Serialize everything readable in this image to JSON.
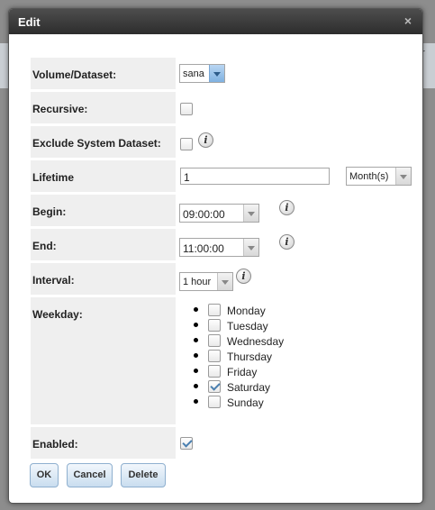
{
  "background": {
    "fragment": "or"
  },
  "dialog": {
    "title": "Edit",
    "close_icon": "×"
  },
  "form": {
    "volume": {
      "label": "Volume/Dataset:",
      "value": "sana"
    },
    "recursive": {
      "label": "Recursive:",
      "checked": false
    },
    "exclude_system": {
      "label": "Exclude System Dataset:",
      "checked": false,
      "info_icon": "i"
    },
    "lifetime": {
      "label": "Lifetime",
      "value": "1",
      "unit": "Month(s)"
    },
    "begin": {
      "label": "Begin:",
      "value": "09:00:00",
      "info_icon": "i"
    },
    "end": {
      "label": "End:",
      "value": "11:00:00",
      "info_icon": "i"
    },
    "interval": {
      "label": "Interval:",
      "value": "1 hour",
      "info_icon": "i"
    },
    "weekday": {
      "label": "Weekday:",
      "days": [
        {
          "name": "Monday",
          "checked": false
        },
        {
          "name": "Tuesday",
          "checked": false
        },
        {
          "name": "Wednesday",
          "checked": false
        },
        {
          "name": "Thursday",
          "checked": false
        },
        {
          "name": "Friday",
          "checked": false
        },
        {
          "name": "Saturday",
          "checked": true
        },
        {
          "name": "Sunday",
          "checked": false
        }
      ]
    },
    "enabled": {
      "label": "Enabled:",
      "checked": true
    }
  },
  "buttons": {
    "ok": "OK",
    "cancel": "Cancel",
    "delete": "Delete"
  },
  "colors": {
    "title_bar": "#3a3a3a",
    "label_bg": "#efefef",
    "accent": "#7fb1e1"
  }
}
